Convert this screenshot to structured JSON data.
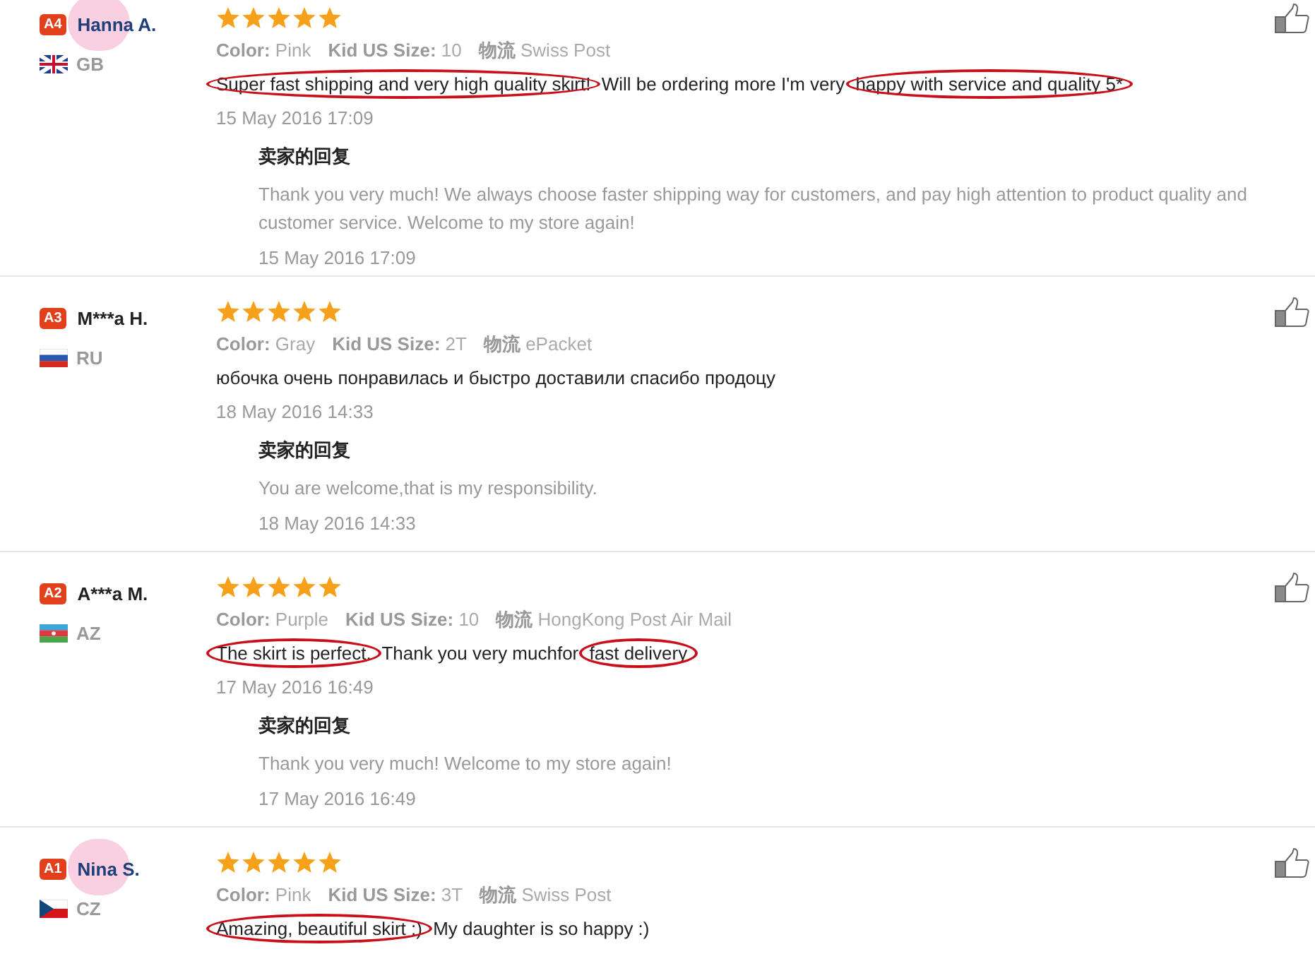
{
  "reviews": [
    {
      "badge": "A4",
      "name": "Hanna A.",
      "sticker": true,
      "country": "GB",
      "flag": {
        "kind": "gb"
      },
      "stars": 5,
      "meta": [
        {
          "label": "Color:",
          "value": "Pink"
        },
        {
          "label": "Kid US Size:",
          "value": "10"
        },
        {
          "label": "物流",
          "value": "Swiss Post"
        }
      ],
      "comment": [
        {
          "text": "Super fast shipping and very high quality skirt!",
          "circled": true
        },
        {
          "text": " Will be ordering more I'm very ",
          "circled": false
        },
        {
          "text": "happy with service and quality 5*",
          "circled": true
        }
      ],
      "date": "15 May 2016 17:09",
      "reply": {
        "title": "卖家的回复",
        "text": "Thank you very much! We always choose faster shipping way for customers, and pay high attention to product quality and customer service. Welcome to my store again!",
        "date": "15 May 2016 17:09"
      }
    },
    {
      "badge": "A3",
      "name": "M***a H.",
      "sticker": false,
      "country": "RU",
      "flag": {
        "kind": "ru"
      },
      "stars": 5,
      "meta": [
        {
          "label": "Color:",
          "value": "Gray"
        },
        {
          "label": "Kid US Size:",
          "value": "2T"
        },
        {
          "label": "物流",
          "value": "ePacket"
        }
      ],
      "comment": [
        {
          "text": "юбочка очень понравилась и быстро доставили спасибо продоцу",
          "circled": false
        }
      ],
      "date": "18 May 2016 14:33",
      "reply": {
        "title": "卖家的回复",
        "text": "You are welcome,that is my responsibility.",
        "date": "18 May 2016 14:33"
      }
    },
    {
      "badge": "A2",
      "name": "A***a M.",
      "sticker": false,
      "country": "AZ",
      "flag": {
        "kind": "az"
      },
      "stars": 5,
      "meta": [
        {
          "label": "Color:",
          "value": "Purple"
        },
        {
          "label": "Kid US Size:",
          "value": "10"
        },
        {
          "label": "物流",
          "value": "HongKong Post Air Mail"
        }
      ],
      "comment": [
        {
          "text": "The skirt is perfect.",
          "circled": true
        },
        {
          "text": " Thank you very muchfor ",
          "circled": false
        },
        {
          "text": "fast delivery",
          "circled": true
        }
      ],
      "date": "17 May 2016 16:49",
      "reply": {
        "title": "卖家的回复",
        "text": "Thank you very much! Welcome to my store again!",
        "date": "17 May 2016 16:49"
      }
    },
    {
      "badge": "A1",
      "name": "Nina S.",
      "sticker": true,
      "country": "CZ",
      "flag": {
        "kind": "cz"
      },
      "stars": 5,
      "meta": [
        {
          "label": "Color:",
          "value": "Pink"
        },
        {
          "label": "Kid US Size:",
          "value": "3T"
        },
        {
          "label": "物流",
          "value": "Swiss Post"
        }
      ],
      "comment": [
        {
          "text": "Amazing, beautiful skirt :)",
          "circled": true
        },
        {
          "text": " My daughter is so happy :)",
          "circled": false
        }
      ]
    }
  ]
}
